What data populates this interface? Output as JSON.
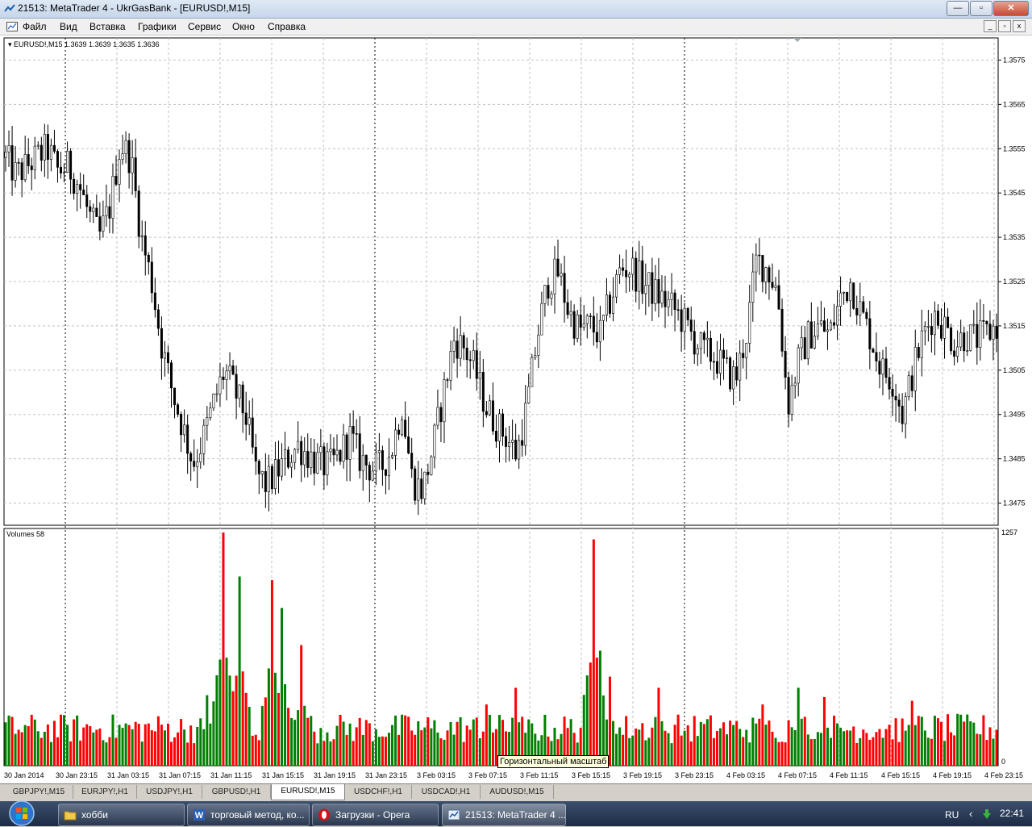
{
  "window": {
    "title": "21513: MetaTrader 4 - UkrGasBank - [EURUSD!,M15]"
  },
  "window_buttons": {
    "minimize": "—",
    "restore": "▫",
    "close": "✕"
  },
  "menu": {
    "items": [
      "Файл",
      "Вид",
      "Вставка",
      "Графики",
      "Сервис",
      "Окно",
      "Справка"
    ]
  },
  "mdi_buttons": [
    "_",
    "▫",
    "x"
  ],
  "chart": {
    "price_header": "▾ EURUSD!,M15  1.3639 1.3639 1.3635 1.3636",
    "volume_header": "Volumes 58",
    "tooltip": "Горизонтальный масштаб"
  },
  "chart_data": {
    "type": "candlestick_bar_chart",
    "symbol": "EURUSD!",
    "timeframe": "M15",
    "ohlc_header": [
      1.3639,
      1.3639,
      1.3635,
      1.3636
    ],
    "price_axis": {
      "ticks": [
        1.3575,
        1.3565,
        1.3555,
        1.3545,
        1.3535,
        1.3525,
        1.3515,
        1.3505,
        1.3495,
        1.3485,
        1.3475
      ],
      "range": [
        1.347,
        1.358
      ]
    },
    "volume_axis": {
      "ticks": [
        1257,
        0
      ],
      "range": [
        0,
        1257
      ]
    },
    "time_axis": {
      "ticks": [
        "30 Jan 2014",
        "30 Jan 23:15",
        "31 Jan 03:15",
        "31 Jan 07:15",
        "31 Jan 11:15",
        "31 Jan 15:15",
        "31 Jan 19:15",
        "31 Jan 23:15",
        "3 Feb 03:15",
        "3 Feb 07:15",
        "3 Feb 11:15",
        "3 Feb 15:15",
        "3 Feb 19:15",
        "3 Feb 23:15",
        "4 Feb 03:15",
        "4 Feb 07:15",
        "4 Feb 11:15",
        "4 Feb 15:15",
        "4 Feb 19:15",
        "4 Feb 23:15"
      ]
    },
    "price_close_path": [
      1.3553,
      1.3549,
      1.3551,
      1.3553,
      1.3555,
      1.355,
      1.3551,
      1.3547,
      1.354,
      1.3535,
      1.3542,
      1.3556,
      1.3553,
      1.3535,
      1.3525,
      1.351,
      1.35,
      1.3492,
      1.3484,
      1.349,
      1.3498,
      1.3505,
      1.35,
      1.3495,
      1.3482,
      1.3479,
      1.3482,
      1.3485,
      1.3488,
      1.3486,
      1.3484,
      1.3483,
      1.3486,
      1.349,
      1.3485,
      1.3483,
      1.3483,
      1.3487,
      1.3497,
      1.348,
      1.3478,
      1.3488,
      1.35,
      1.3512,
      1.351,
      1.3505,
      1.3497,
      1.3493,
      1.349,
      1.3486,
      1.3497,
      1.3513,
      1.3525,
      1.3527,
      1.3518,
      1.3514,
      1.3515,
      1.3513,
      1.3521,
      1.3528,
      1.3528,
      1.3525,
      1.3523,
      1.3521,
      1.3519,
      1.3516,
      1.3512,
      1.3509,
      1.3508,
      1.3505,
      1.3503,
      1.3513,
      1.353,
      1.3528,
      1.3523,
      1.3497,
      1.3507,
      1.3513,
      1.3515,
      1.3513,
      1.3521,
      1.3525,
      1.3518,
      1.3512,
      1.3505,
      1.3503,
      1.3495,
      1.3505,
      1.3513,
      1.3518,
      1.3515,
      1.3511,
      1.3513,
      1.3512,
      1.3513,
      1.3515
    ],
    "volume_series": {
      "colors": {
        "up": "#008000",
        "down": "#ff0000"
      },
      "notable_peaks": [
        1257,
        1220,
        820,
        780,
        750,
        720
      ]
    },
    "colors": {
      "background": "#ffffff",
      "candles": "#000000",
      "grid": "#c0c0c0"
    }
  },
  "tabs": {
    "items": [
      "GBPJPY!,M15",
      "EURJPY!,H1",
      "USDJPY!,H1",
      "GBPUSD!,H1",
      "EURUSD!,M15",
      "USDCHF!,H1",
      "USDCAD!,H1",
      "AUDUSD!,M15"
    ],
    "active": "EURUSD!,M15"
  },
  "taskbar": {
    "items": [
      {
        "label": "хобби",
        "icon": "folder-icon"
      },
      {
        "label": "торговый метод, ко...",
        "icon": "word-icon"
      },
      {
        "label": "Загрузки - Opera",
        "icon": "opera-icon"
      },
      {
        "label": "21513: MetaTrader 4 ...",
        "icon": "metatrader-icon"
      }
    ],
    "lang": "RU",
    "clock": "22:41"
  }
}
